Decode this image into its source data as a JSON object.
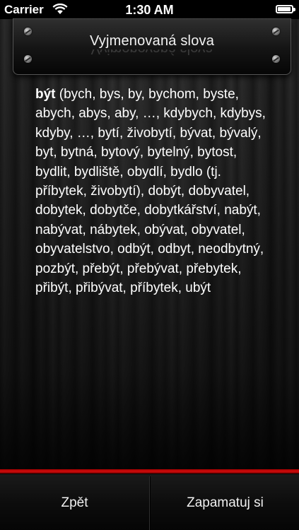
{
  "status_bar": {
    "carrier": "Carrier",
    "time": "1:30 AM",
    "wifi_icon": "wifi-icon",
    "battery_icon": "battery-icon"
  },
  "header": {
    "title": "Vyjmenovaná slova"
  },
  "content": {
    "headword": "být",
    "text": " (bych, bys, by, bychom, byste, abych, abys, aby, …, kdybych, kdybys, kdyby, …, bytí, živobytí, bývat, bývalý, byt, bytná, bytový, bytelný, bytost, bydlit, bydliště, obydlí, bydlo (tj. příbytek, živobytí), dobýt, dobyvatel, dobytek, dobytče, dobytkářství, nabýt, nabývat, nábytek, obývat, obyvatel, obyvatelstvo, odbýt, odbyt, neodbytný, pozbýt, přebýt, přebývat, přebytek, přibýt, přibývat, příbytek, ubýt"
  },
  "toolbar": {
    "back_label": "Zpět",
    "remember_label": "Zapamatuj si"
  },
  "colors": {
    "accent_red": "#d20c0c",
    "text": "#ffffff",
    "background": "#1e1e1e"
  }
}
